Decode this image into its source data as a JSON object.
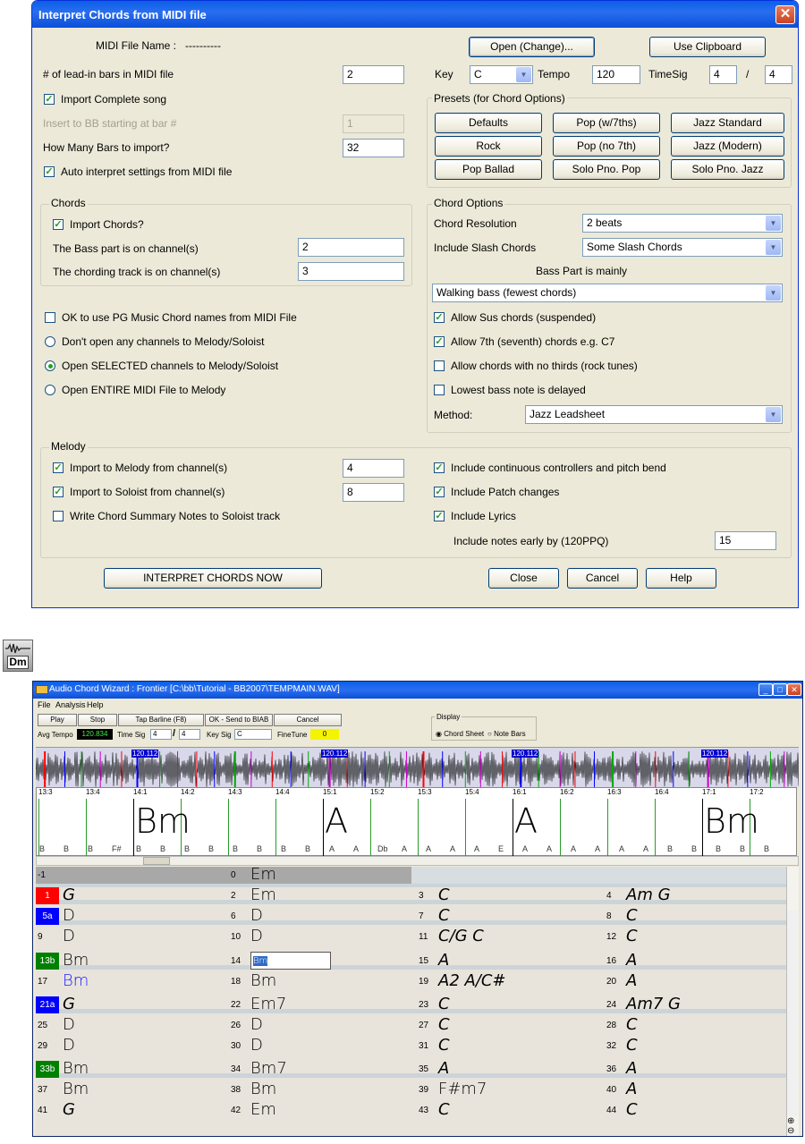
{
  "dialog": {
    "title": "Interpret Chords from MIDI file",
    "close_glyph": "✕",
    "midi_file_label": "MIDI File Name :",
    "midi_file_value": "----------",
    "open_button": "Open (Change)...",
    "clipboard_button": "Use Clipboard",
    "leadin_label": "# of lead-in bars in MIDI file",
    "leadin_value": "2",
    "key_label": "Key",
    "key_value": "C",
    "tempo_label": "Tempo",
    "tempo_value": "120",
    "timesig_label": "TimeSig",
    "timesig_num": "4",
    "timesig_sep": "/",
    "timesig_den": "4",
    "import_complete_label": "Import Complete song",
    "insert_label": "Insert to BB starting at bar #",
    "insert_value": "1",
    "howmany_label": "How Many Bars to import?",
    "howmany_value": "32",
    "auto_label": "Auto interpret settings from MIDI file",
    "presets_title": "Presets  (for Chord Options)",
    "presets": [
      "Defaults",
      "Pop (w/7ths)",
      "Jazz Standard",
      "Rock",
      "Pop (no 7th)",
      "Jazz (Modern)",
      "Pop Ballad",
      "Solo Pno. Pop",
      "Solo Pno. Jazz"
    ],
    "chords_group": "Chords",
    "import_chords_label": "Import Chords?",
    "bass_channel_label": "The Bass part is on channel(s)",
    "bass_channel_value": "2",
    "chording_channel_label": "The chording track is on channel(s)",
    "chording_channel_value": "3",
    "pg_names_label": "OK to use PG Music Chord names from MIDI File",
    "radio_none": "Don't open any channels to Melody/Soloist",
    "radio_selected": "Open SELECTED channels to Melody/Soloist",
    "radio_entire": "Open ENTIRE MIDI File to Melody",
    "chord_options_title": "Chord Options",
    "resolution_label": "Chord Resolution",
    "resolution_value": "2 beats",
    "slash_label": "Include Slash Chords",
    "slash_value": "Some Slash Chords",
    "bass_mainly_label": "Bass Part is mainly",
    "bass_mainly_value": "Walking bass (fewest chords)",
    "sus_label": "Allow Sus chords (suspended)",
    "seventh_label": "Allow 7th (seventh) chords e.g. C7",
    "nothirds_label": "Allow chords with no thirds (rock tunes)",
    "lowbass_label": "Lowest bass note is delayed",
    "method_label": "Method:",
    "method_value": "Jazz Leadsheet",
    "melody_group": "Melody",
    "melody_ch_label": "Import to Melody from channel(s)",
    "melody_ch_value": "4",
    "soloist_ch_label": "Import to Soloist from channel(s)",
    "soloist_ch_value": "8",
    "summary_label": "Write Chord Summary Notes to Soloist track",
    "controllers_label": "Include continuous controllers and pitch bend",
    "patch_label": "Include Patch changes",
    "lyrics_label": "Include Lyrics",
    "early_label": "Include notes early by (120PPQ)",
    "early_value": "15",
    "interpret_button": "INTERPRET CHORDS NOW",
    "close_button": "Close",
    "cancel_button": "Cancel",
    "help_button": "Help",
    "check_mark": "✓"
  },
  "icon": {
    "label": "Dm"
  },
  "wizard": {
    "title": "Audio Chord Wizard : Frontier [C:\\bb\\Tutorial - BB2007\\TEMPMAIN.WAV]",
    "menu": [
      "File",
      "Analysis",
      "Help"
    ],
    "buttons": [
      "Play",
      "Stop",
      "Tap Barline (F8)",
      "OK - Send to BIAB",
      "Cancel"
    ],
    "avg_tempo_label": "Avg Tempo",
    "avg_tempo_value": "120.834",
    "time_sig_label": "Time Sig",
    "time_sig_num": "4",
    "time_sig_den": "4",
    "key_sig_label": "Key Sig",
    "key_sig_value": "C",
    "finetune_label": "FineTune",
    "finetune_value": "0",
    "display_label": "Display",
    "display_chord_sheet": "Chord Sheet",
    "display_note_bars": "Note Bars",
    "markers": [
      "120.112",
      "120.112",
      "120.112",
      "120.112"
    ],
    "ruler": [
      "13:3",
      "13:4",
      "14:1",
      "14:2",
      "14:3",
      "14:4",
      "15:1",
      "15:2",
      "15:3",
      "15:4",
      "16:1",
      "16:2",
      "16:3",
      "16:4",
      "17:1",
      "17:2"
    ],
    "big_chords": [
      "Bm",
      "A",
      "A",
      "Bm"
    ],
    "bass_notes": [
      "B",
      "B",
      "B",
      "F#",
      "B",
      "B",
      "B",
      "B",
      "B",
      "B",
      "B",
      "B",
      "A",
      "A",
      "Db",
      "A",
      "A",
      "A",
      "A",
      "E",
      "A",
      "A",
      "A",
      "A",
      "A",
      "A",
      "B",
      "B",
      "B",
      "B",
      "B"
    ],
    "rows": [
      {
        "tag": "-1",
        "tagcolor": "",
        "cells": [
          [
            "-1",
            ""
          ],
          [
            "0",
            "Em"
          ],
          [
            "",
            ""
          ],
          [
            "",
            ""
          ]
        ]
      },
      {
        "tag": "1",
        "tagcolor": "#ff0000",
        "cells": [
          [
            "",
            "G"
          ],
          [
            "2",
            "Em"
          ],
          [
            "3",
            "C"
          ],
          [
            "4",
            "Am      G"
          ]
        ]
      },
      {
        "tag": "5a",
        "tagcolor": "#0000ff",
        "cells": [
          [
            "",
            "D"
          ],
          [
            "6",
            "D"
          ],
          [
            "7",
            "C"
          ],
          [
            "8",
            "C"
          ]
        ]
      },
      {
        "tag": "",
        "tagcolor": "",
        "cells": [
          [
            "9",
            "D"
          ],
          [
            "10",
            "D"
          ],
          [
            "11",
            "C/G        C"
          ],
          [
            "12",
            "C"
          ]
        ]
      },
      {
        "tag": "13b",
        "tagcolor": "#008000",
        "cells": [
          [
            "",
            "Bm"
          ],
          [
            "14",
            "Bm"
          ],
          [
            "15",
            "A"
          ],
          [
            "16",
            "A"
          ]
        ]
      },
      {
        "tag": "",
        "tagcolor": "",
        "cells": [
          [
            "17",
            "Bm"
          ],
          [
            "18",
            "Bm"
          ],
          [
            "19",
            "A2         A/C#"
          ],
          [
            "20",
            "A"
          ]
        ]
      },
      {
        "tag": "21a",
        "tagcolor": "#0000ff",
        "cells": [
          [
            "",
            "G"
          ],
          [
            "22",
            "Em7"
          ],
          [
            "23",
            "C"
          ],
          [
            "24",
            "Am7     G"
          ]
        ]
      },
      {
        "tag": "",
        "tagcolor": "",
        "cells": [
          [
            "25",
            "D"
          ],
          [
            "26",
            "D"
          ],
          [
            "27",
            "C"
          ],
          [
            "28",
            "C"
          ]
        ]
      },
      {
        "tag": "",
        "tagcolor": "",
        "cells": [
          [
            "29",
            "D"
          ],
          [
            "30",
            "D"
          ],
          [
            "31",
            "C"
          ],
          [
            "32",
            "C"
          ]
        ]
      },
      {
        "tag": "33b",
        "tagcolor": "#008000",
        "cells": [
          [
            "",
            "Bm"
          ],
          [
            "34",
            "Bm7"
          ],
          [
            "35",
            "A"
          ],
          [
            "36",
            "A"
          ]
        ]
      },
      {
        "tag": "",
        "tagcolor": "",
        "cells": [
          [
            "37",
            "Bm"
          ],
          [
            "38",
            "Bm"
          ],
          [
            "39",
            "F#m7"
          ],
          [
            "40",
            "A"
          ]
        ]
      },
      {
        "tag": "",
        "tagcolor": "",
        "cells": [
          [
            "41",
            "G"
          ],
          [
            "42",
            "Em"
          ],
          [
            "43",
            "C"
          ],
          [
            "44",
            "C"
          ]
        ]
      }
    ]
  }
}
